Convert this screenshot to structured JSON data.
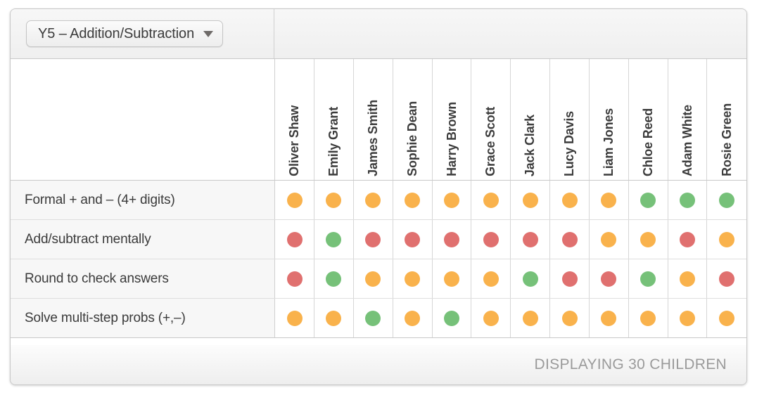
{
  "toolbar": {
    "unit_selector": {
      "label": "Y5 – Addition/Subtraction",
      "caret_icon": "chevron-down-icon"
    }
  },
  "grid": {
    "children": [
      "Oliver Shaw",
      "Emily Grant",
      "James Smith",
      "Sophie Dean",
      "Harry Brown",
      "Grace Scott",
      "Jack Clark",
      "Lucy Davis",
      "Liam Jones",
      "Chloe Reed",
      "Adam White",
      "Rosie Green"
    ],
    "objectives": [
      "Formal + and –  (4+ digits)",
      "Add/subtract mentally",
      "Round to check answers",
      "Solve multi-step probs (+,–)"
    ],
    "statuses": [
      [
        "amber",
        "amber",
        "amber",
        "amber",
        "amber",
        "amber",
        "amber",
        "amber",
        "amber",
        "green",
        "green",
        "green"
      ],
      [
        "red",
        "green",
        "red",
        "red",
        "red",
        "red",
        "red",
        "red",
        "amber",
        "amber",
        "red",
        "amber"
      ],
      [
        "red",
        "green",
        "amber",
        "amber",
        "amber",
        "amber",
        "green",
        "red",
        "red",
        "green",
        "amber",
        "red"
      ],
      [
        "amber",
        "amber",
        "green",
        "amber",
        "green",
        "amber",
        "amber",
        "amber",
        "amber",
        "amber",
        "amber",
        "amber"
      ]
    ],
    "status_colors": {
      "green": "#76c179",
      "amber": "#f9b24c",
      "red": "#e0706f"
    }
  },
  "footer": {
    "count_text": "DISPLAYING 30 CHILDREN"
  }
}
